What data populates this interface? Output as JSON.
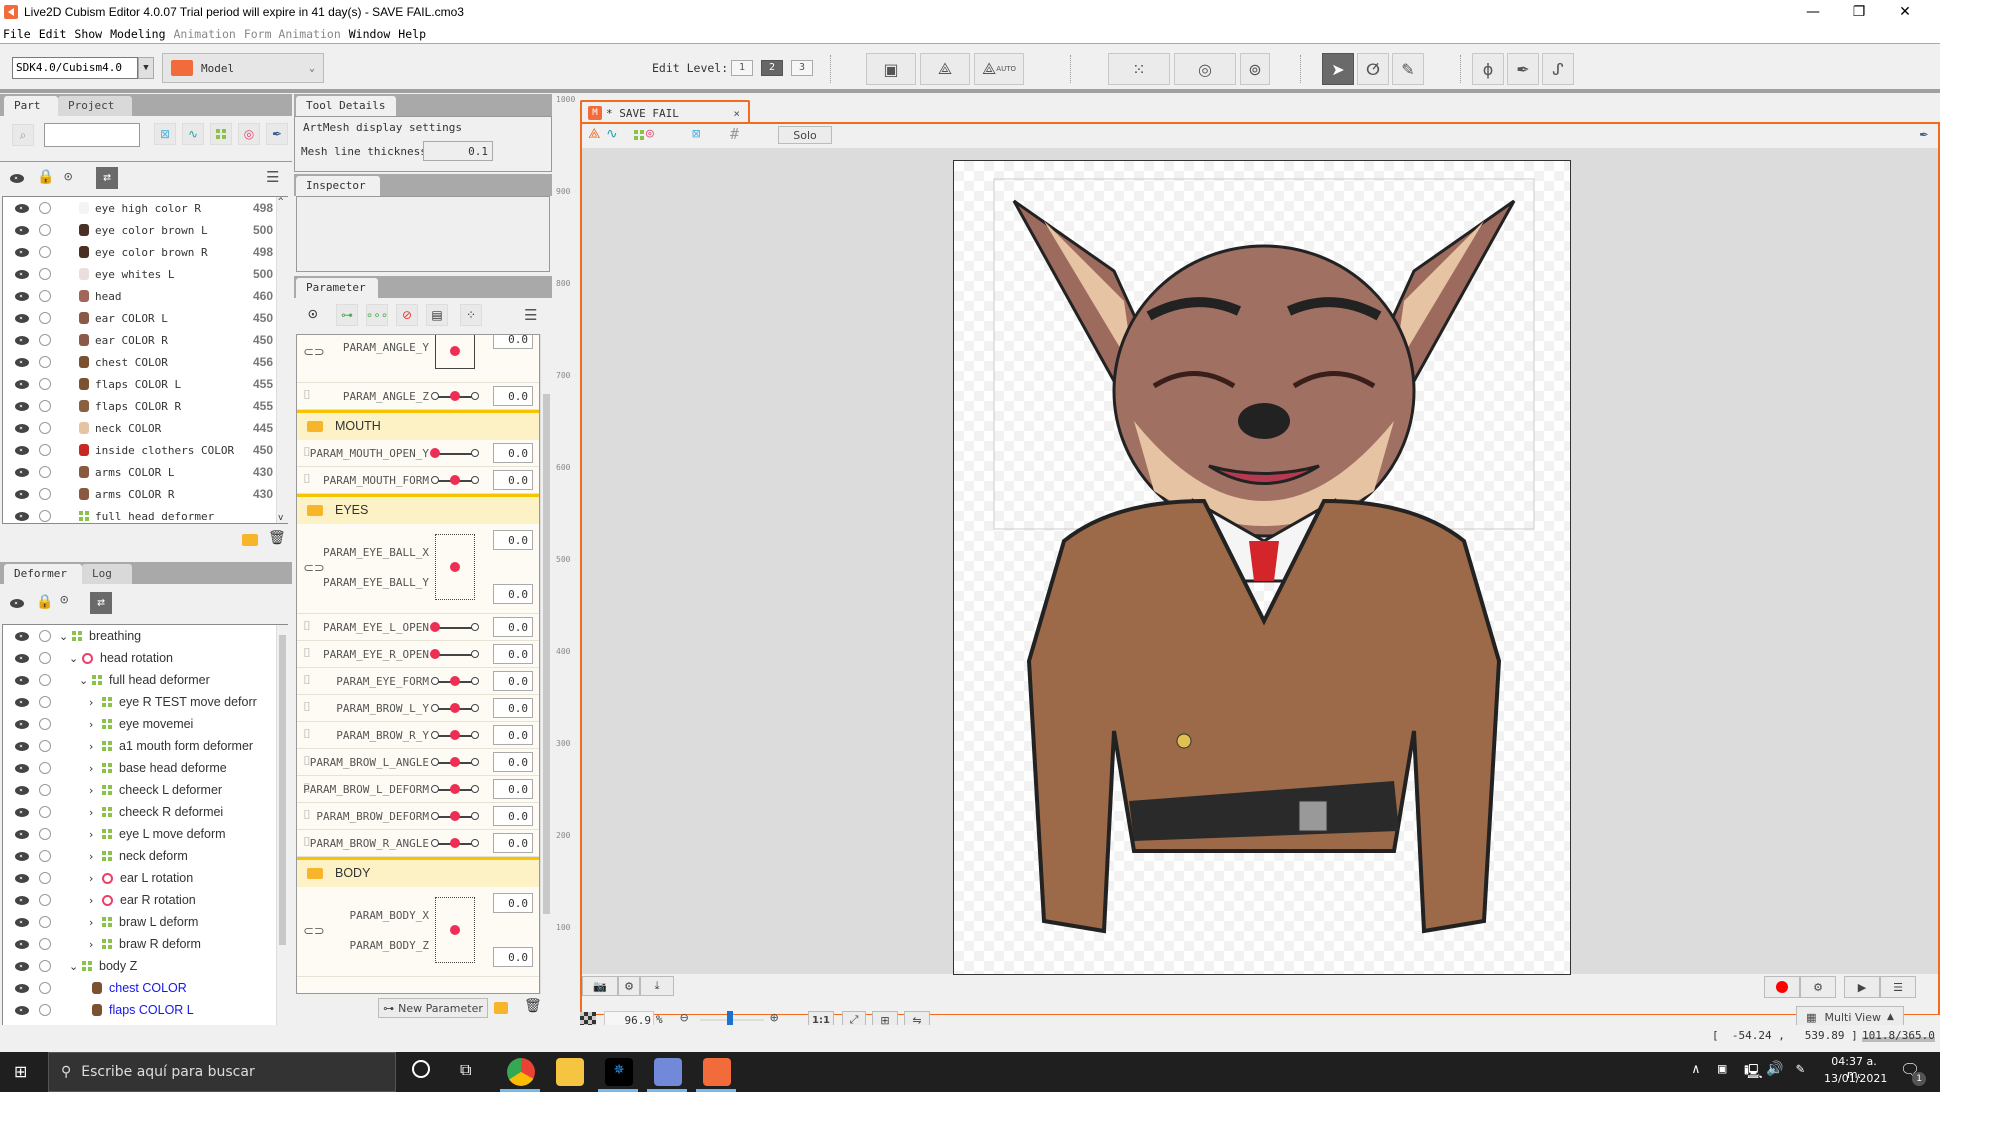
{
  "window": {
    "title": "Live2D Cubism Editor 4.0.07   Trial period will expire in 41 day(s)  - SAVE FAIL.cmo3",
    "minimize": "—",
    "restore": "❐",
    "close": "✕"
  },
  "menu": [
    {
      "label": "File",
      "enabled": true
    },
    {
      "label": "Edit",
      "enabled": true
    },
    {
      "label": "Show",
      "enabled": true
    },
    {
      "label": "Modeling",
      "enabled": true
    },
    {
      "label": "Animation",
      "enabled": false
    },
    {
      "label": "Form Animation",
      "enabled": false
    },
    {
      "label": "Window",
      "enabled": true
    },
    {
      "label": "Help",
      "enabled": true
    }
  ],
  "toolbar": {
    "sdk_version": "SDK4.0/Cubism4.0",
    "mode": "Model",
    "edit_level_label": "Edit Level:",
    "edit_levels": [
      "1",
      "2",
      "3"
    ],
    "edit_level_selected": "2",
    "auto_label": "AUTO"
  },
  "part_panel": {
    "tabs": [
      "Part",
      "Project"
    ],
    "active_tab": "Part",
    "search_value": "",
    "items": [
      {
        "name": "eye high color R",
        "value": "498",
        "thumb": "#f4f4f4"
      },
      {
        "name": "eye color brown L",
        "value": "500",
        "thumb": "#4a3024"
      },
      {
        "name": "eye color brown R",
        "value": "498",
        "thumb": "#4a3024"
      },
      {
        "name": "eye whites L",
        "value": "500",
        "thumb": "#eadede"
      },
      {
        "name": "head",
        "value": "460",
        "thumb": "#a0675a"
      },
      {
        "name": "ear COLOR L",
        "value": "450",
        "thumb": "#8a5a48"
      },
      {
        "name": "ear COLOR R",
        "value": "450",
        "thumb": "#8a5a48"
      },
      {
        "name": "chest COLOR",
        "value": "456",
        "thumb": "#7a5232"
      },
      {
        "name": "flaps COLOR L",
        "value": "455",
        "thumb": "#7a5232"
      },
      {
        "name": "flaps COLOR R",
        "value": "455",
        "thumb": "#8a6040"
      },
      {
        "name": "neck COLOR",
        "value": "445",
        "thumb": "#e6c3a2"
      },
      {
        "name": "inside clothers COLOR",
        "value": "450",
        "thumb": "#c42a22"
      },
      {
        "name": "arms COLOR L",
        "value": "430",
        "thumb": "#8a5a40"
      },
      {
        "name": "arms COLOR R",
        "value": "430",
        "thumb": "#8a5a40"
      },
      {
        "name": "full head deformer",
        "value": "",
        "thumb": "deformer"
      }
    ]
  },
  "deformer_panel": {
    "tabs": [
      "Deformer",
      "Log"
    ],
    "active_tab": "Deformer",
    "items": [
      {
        "name": "breathing",
        "type": "warp",
        "indent": 0,
        "expand": "open",
        "blue": false
      },
      {
        "name": "head rotation",
        "type": "rotation",
        "indent": 1,
        "expand": "open",
        "blue": false
      },
      {
        "name": "full head deformer",
        "type": "warp",
        "indent": 2,
        "expand": "open",
        "blue": false
      },
      {
        "name": "eye R TEST move deforr",
        "type": "warp",
        "indent": 3,
        "expand": "closed",
        "blue": false
      },
      {
        "name": "eye movemei",
        "type": "warp",
        "indent": 3,
        "expand": "closed",
        "blue": false
      },
      {
        "name": "a1 mouth form deformer",
        "type": "warp",
        "indent": 3,
        "expand": "closed",
        "blue": false
      },
      {
        "name": "base head deforme",
        "type": "warp",
        "indent": 3,
        "expand": "closed",
        "blue": false
      },
      {
        "name": "cheeck L deformer",
        "type": "warp",
        "indent": 3,
        "expand": "closed",
        "blue": false
      },
      {
        "name": "cheeck R deformei",
        "type": "warp",
        "indent": 3,
        "expand": "closed",
        "blue": false
      },
      {
        "name": "eye L move deform",
        "type": "warp",
        "indent": 3,
        "expand": "closed",
        "blue": false
      },
      {
        "name": "neck deform",
        "type": "warp",
        "indent": 3,
        "expand": "closed",
        "blue": false
      },
      {
        "name": "ear L rotation",
        "type": "rotation",
        "indent": 3,
        "expand": "closed",
        "blue": false
      },
      {
        "name": "ear R rotation",
        "type": "rotation",
        "indent": 3,
        "expand": "closed",
        "blue": false
      },
      {
        "name": "braw L deform",
        "type": "warp",
        "indent": 3,
        "expand": "closed",
        "blue": false
      },
      {
        "name": "braw R deform",
        "type": "warp",
        "indent": 3,
        "expand": "closed",
        "blue": false
      },
      {
        "name": "body Z",
        "type": "warp",
        "indent": 1,
        "expand": "open",
        "blue": false
      },
      {
        "name": "chest COLOR",
        "type": "part",
        "indent": 2,
        "expand": "none",
        "blue": true
      },
      {
        "name": "flaps COLOR L",
        "type": "part",
        "indent": 2,
        "expand": "none",
        "blue": true
      }
    ]
  },
  "tool_details": {
    "tab": "Tool Details",
    "section": "ArtMesh display settings",
    "mesh_line_thickness_label": "Mesh line thickness",
    "mesh_line_thickness_value": "0.1"
  },
  "inspector": {
    "tab": "Inspector"
  },
  "parameter_panel": {
    "tab": "Parameter",
    "new_parameter_label": "New Parameter",
    "rows": [
      {
        "kind": "param2d",
        "labels": [
          "PARAM_ANGLE_Y"
        ],
        "values": [
          "0.0"
        ]
      },
      {
        "kind": "param",
        "label": "PARAM_ANGLE_Z",
        "value": "0.0",
        "position": 0.5
      },
      {
        "kind": "group",
        "label": "MOUTH"
      },
      {
        "kind": "param",
        "label": "PARAM_MOUTH_OPEN_Y",
        "value": "0.0",
        "position": 0
      },
      {
        "kind": "param",
        "label": "PARAM_MOUTH_FORM",
        "value": "0.0",
        "position": 0.5
      },
      {
        "kind": "group",
        "label": "EYES"
      },
      {
        "kind": "param2d",
        "labels": [
          "PARAM_EYE_BALL_X",
          "PARAM_EYE_BALL_Y"
        ],
        "values": [
          "0.0",
          "0.0"
        ]
      },
      {
        "kind": "param",
        "label": "PARAM_EYE_L_OPEN",
        "value": "0.0",
        "position": 0
      },
      {
        "kind": "param",
        "label": "PARAM_EYE_R_OPEN",
        "value": "0.0",
        "position": 0
      },
      {
        "kind": "param",
        "label": "PARAM_EYE_FORM",
        "value": "0.0",
        "position": 0.5
      },
      {
        "kind": "param",
        "label": "PARAM_BROW_L_Y",
        "value": "0.0",
        "position": 0.5
      },
      {
        "kind": "param",
        "label": "PARAM_BROW_R_Y",
        "value": "0.0",
        "position": 0.5
      },
      {
        "kind": "param",
        "label": "PARAM_BROW_L_ANGLE",
        "value": "0.0",
        "position": 0.5
      },
      {
        "kind": "param",
        "label": "PARAM_BROW_L_DEFORM",
        "value": "0.0",
        "position": 0.5
      },
      {
        "kind": "param",
        "label": "PARAM_BROW_DEFORM",
        "value": "0.0",
        "position": 0.5
      },
      {
        "kind": "param",
        "label": "PARAM_BROW_R_ANGLE",
        "value": "0.0",
        "position": 0.5
      },
      {
        "kind": "group",
        "label": "BODY"
      },
      {
        "kind": "param2d",
        "labels": [
          "PARAM_BODY_X",
          "PARAM_BODY_Z"
        ],
        "values": [
          "0.0",
          "0.0"
        ]
      }
    ]
  },
  "viewport": {
    "tab_title": "* SAVE FAIL",
    "tab_close": "×",
    "solo_label": "Solo",
    "zoom_value": "96.9",
    "zoom_unit": "%",
    "zoom_slider": 0.47,
    "one_to_one": "1:1",
    "multi_view_label": "Multi View",
    "ruler_ticks": [
      "1000",
      "900",
      "800",
      "700",
      "600",
      "500",
      "400",
      "300",
      "200",
      "100"
    ]
  },
  "status": {
    "coords": "[  -54.24 ,   539.89 ]",
    "memory": "101.8/365.0"
  },
  "taskbar": {
    "search_placeholder": "Escribe aquí para buscar",
    "time": "04:37 a. m.",
    "date": "13/01/2021",
    "notifications": "1"
  },
  "colors": {
    "accent": "#f26b21",
    "param_red": "#ef2e55",
    "group_yellow": "#f5c400",
    "deformer_green": "#8bc34a",
    "rotation_pink": "#e8416a"
  }
}
